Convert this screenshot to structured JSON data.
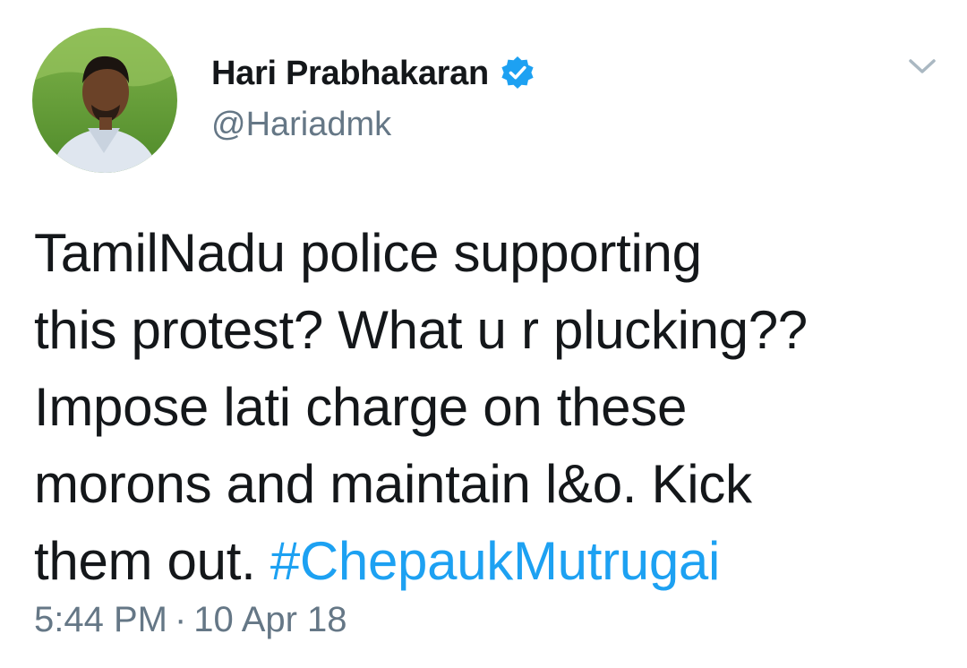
{
  "author": {
    "display_name": "Hari Prabhakaran",
    "handle": "@Hariadmk",
    "verified": true,
    "avatar_icon": "profile-photo"
  },
  "menu": {
    "icon": "chevron-down-icon"
  },
  "tweet": {
    "lines": [
      "TamilNadu police supporting",
      "this protest? What u r plucking??",
      "Impose lati charge on these",
      "morons and maintain l&o. Kick",
      "them out."
    ],
    "hashtag": "#ChepaukMutrugai",
    "time": "5:44 PM",
    "separator": "·",
    "date": "10 Apr 18"
  },
  "colors": {
    "text": "#14171a",
    "secondary": "#657786",
    "link": "#1da1f2",
    "verified": "#1da1f2"
  }
}
